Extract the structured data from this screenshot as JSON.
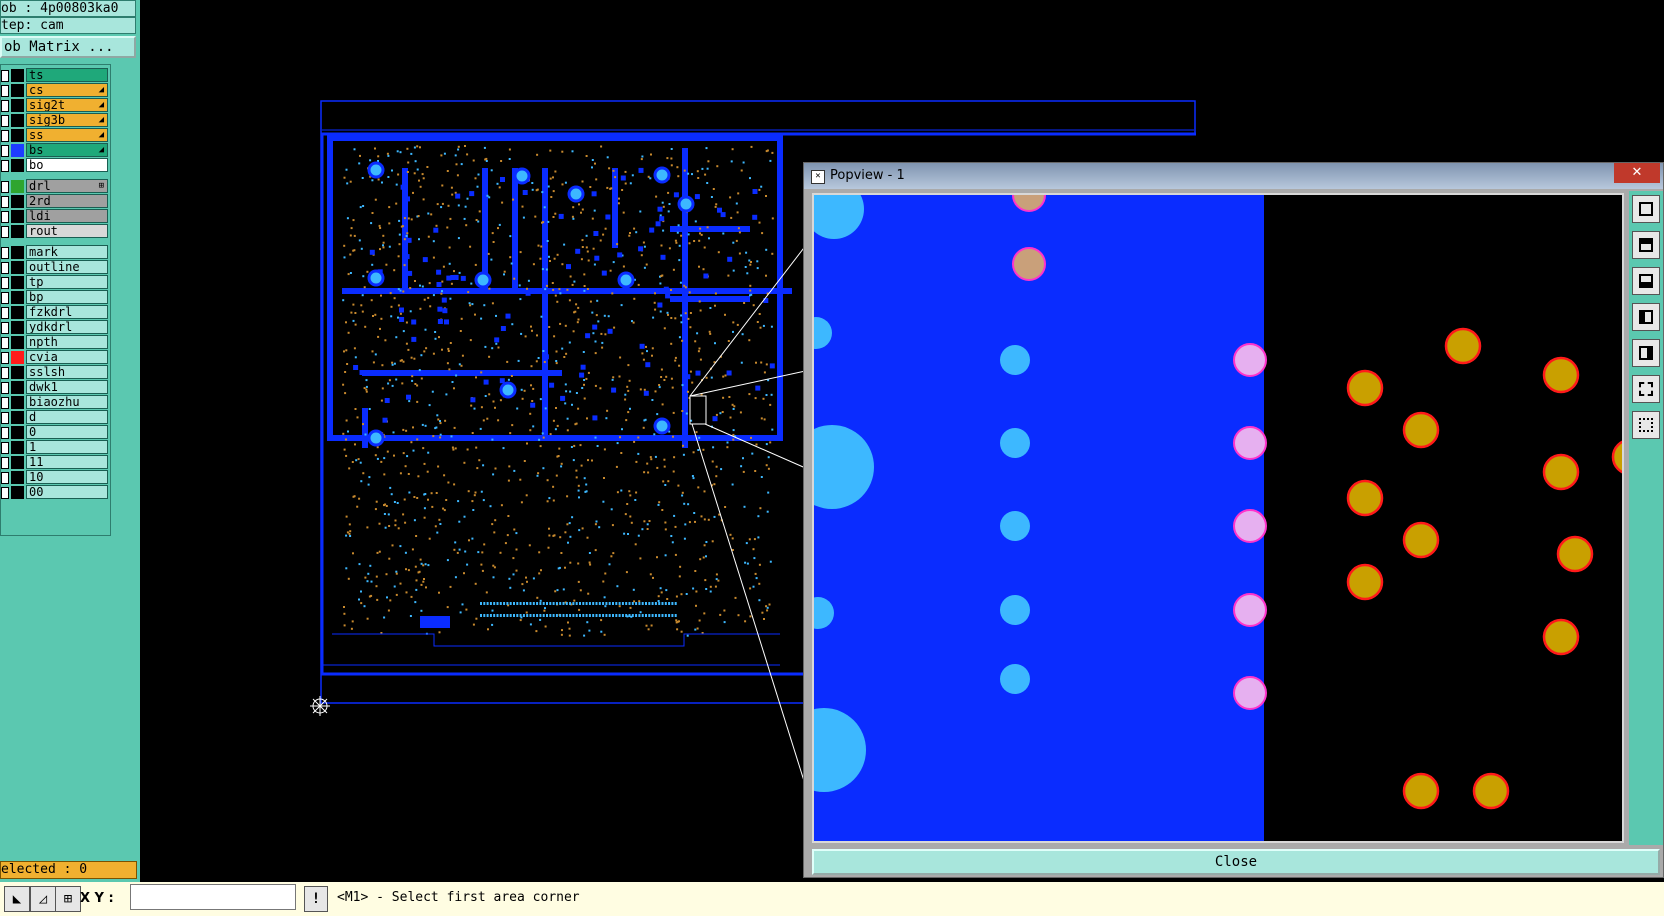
{
  "header": {
    "job": "ob : 4p00803ka0",
    "step": "tep: cam",
    "job_matrix": "ob Matrix ..."
  },
  "layers": [
    {
      "name": "ts",
      "color": "#1fa87a",
      "swatch": "#000000",
      "flag": ""
    },
    {
      "name": "cs",
      "color": "#f0b030",
      "swatch": "#000000",
      "flag": "◢"
    },
    {
      "name": "sig2t",
      "color": "#f0b030",
      "swatch": "#000000",
      "flag": "◢"
    },
    {
      "name": "sig3b",
      "color": "#f0b030",
      "swatch": "#000000",
      "flag": "◢"
    },
    {
      "name": "ss",
      "color": "#f0b030",
      "swatch": "#000000",
      "flag": "◢"
    },
    {
      "name": "bs",
      "color": "#1fa87a",
      "swatch": "#1e3cff",
      "flag": "◢"
    },
    {
      "name": "bo",
      "color": "#ffffff",
      "swatch": "#000000",
      "flag": ""
    },
    {
      "name": "drl",
      "color": "#a0a0a0",
      "swatch": "#2fa52f",
      "flag": "⊞"
    },
    {
      "name": "2rd",
      "color": "#a0a0a0",
      "swatch": "#000000",
      "flag": ""
    },
    {
      "name": "ldi",
      "color": "#a0a0a0",
      "swatch": "#000000",
      "flag": ""
    },
    {
      "name": "rout",
      "color": "#d8d8d8",
      "swatch": "#000000",
      "flag": ""
    },
    {
      "name": "mark",
      "color": "#a8e6dc",
      "swatch": "#000000",
      "flag": ""
    },
    {
      "name": "outline",
      "color": "#a8e6dc",
      "swatch": "#000000",
      "flag": ""
    },
    {
      "name": "tp",
      "color": "#a8e6dc",
      "swatch": "#000000",
      "flag": ""
    },
    {
      "name": "bp",
      "color": "#a8e6dc",
      "swatch": "#000000",
      "flag": ""
    },
    {
      "name": "fzkdrl",
      "color": "#a8e6dc",
      "swatch": "#000000",
      "flag": ""
    },
    {
      "name": "ydkdrl",
      "color": "#a8e6dc",
      "swatch": "#000000",
      "flag": ""
    },
    {
      "name": "npth",
      "color": "#a8e6dc",
      "swatch": "#000000",
      "flag": ""
    },
    {
      "name": "cvia",
      "color": "#a8e6dc",
      "swatch": "#ff1a1a",
      "flag": ""
    },
    {
      "name": "sslsh",
      "color": "#a8e6dc",
      "swatch": "#000000",
      "flag": ""
    },
    {
      "name": "dwk1",
      "color": "#a8e6dc",
      "swatch": "#000000",
      "flag": ""
    },
    {
      "name": "biaozhu",
      "color": "#a8e6dc",
      "swatch": "#000000",
      "flag": ""
    },
    {
      "name": "d",
      "color": "#a8e6dc",
      "swatch": "#000000",
      "flag": ""
    },
    {
      "name": "0",
      "color": "#a8e6dc",
      "swatch": "#000000",
      "flag": ""
    },
    {
      "name": "1",
      "color": "#a8e6dc",
      "swatch": "#000000",
      "flag": ""
    },
    {
      "name": "11",
      "color": "#a8e6dc",
      "swatch": "#000000",
      "flag": ""
    },
    {
      "name": "10",
      "color": "#a8e6dc",
      "swatch": "#000000",
      "flag": ""
    },
    {
      "name": "00",
      "color": "#a8e6dc",
      "swatch": "#000000",
      "flag": ""
    }
  ],
  "selected": "elected : 0",
  "statusbar": {
    "xy_label": "X Y :",
    "xy_value": "",
    "prompt": "<M1> - Select first area corner",
    "info_button": "!"
  },
  "popview": {
    "title": "Popview - 1",
    "close_x": "✕",
    "close_label": "Close"
  },
  "colors": {
    "board_blue": "#0a2cff",
    "pad_cyan": "#3db8ff",
    "pad_pink": "#e6a8f0",
    "pad_gold": "#c9a000",
    "pad_red_ring": "#ff1a1a",
    "panel_teal": "#5bc8b0"
  }
}
